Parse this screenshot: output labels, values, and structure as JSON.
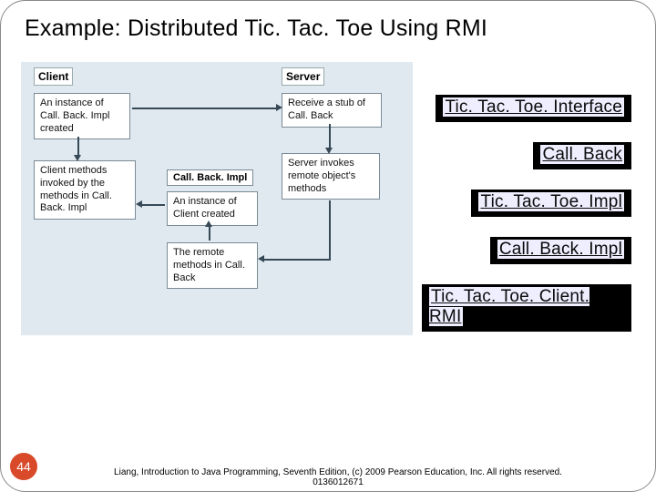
{
  "title": "Example: Distributed Tic. Tac. Toe Using RMI",
  "diagram": {
    "client_label": "Client",
    "server_label": "Server",
    "callbackimpl_label": "Call. Back. Impl",
    "boxes": {
      "client_instance": "An instance of Call. Back. Impl created",
      "client_methods": "Client methods invoked by the methods in Call. Back. Impl",
      "cb_instance": "An instance of Client created",
      "cb_remote": "The remote methods in Call. Back",
      "srv_receive": "Receive a stub of Call. Back",
      "srv_invoke": "Server invokes remote object's methods"
    }
  },
  "buttons": [
    "Tic. Tac. Toe. Interface",
    "Call. Back",
    "Tic. Tac. Toe. Impl",
    "Call. Back. Impl",
    "Tic. Tac. Toe. Client. RMI"
  ],
  "page_number": "44",
  "copyright": "Liang, Introduction to Java Programming, Seventh Edition, (c) 2009 Pearson Education, Inc. All rights reserved. 0136012671"
}
